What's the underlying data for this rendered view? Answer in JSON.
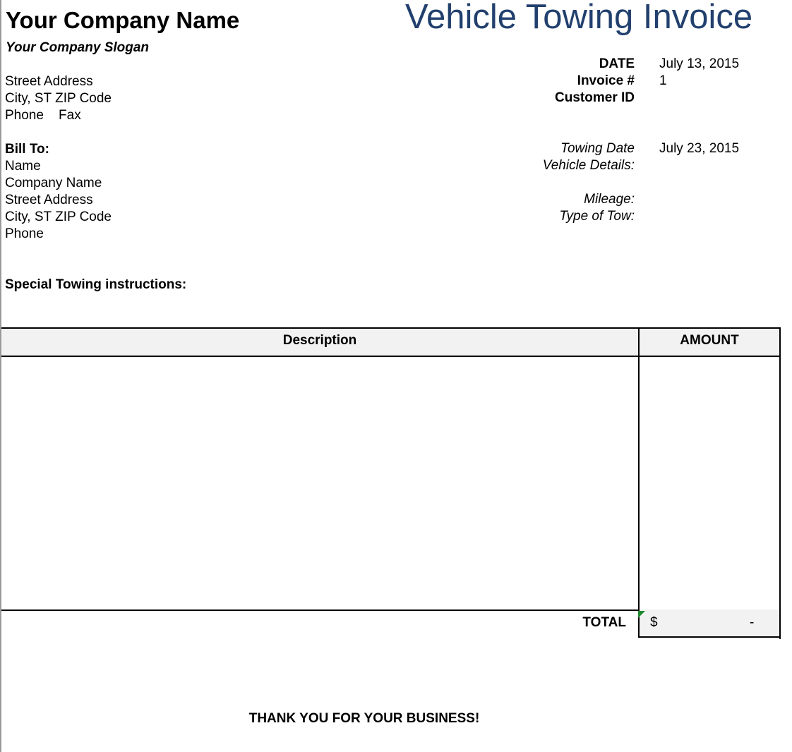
{
  "company": {
    "name": "Your Company Name",
    "slogan": "Your Company Slogan",
    "street": "Street Address",
    "city_line": "City, ST  ZIP Code",
    "phone_fax": "Phone    Fax"
  },
  "invoice": {
    "title": "Vehicle Towing Invoice",
    "title_color": "#22406e",
    "meta": [
      {
        "label": "DATE",
        "value": "July 13, 2015"
      },
      {
        "label": "Invoice #",
        "value": "1"
      },
      {
        "label": "Customer ID",
        "value": ""
      }
    ]
  },
  "bill_to": {
    "heading": "Bill To:",
    "lines": [
      "Name",
      "Company Name",
      "Street Address",
      "City, ST  ZIP Code",
      "Phone"
    ]
  },
  "towing": {
    "fields": [
      {
        "label": "Towing Date",
        "value": "July 23, 2015"
      },
      {
        "label": "Vehicle Details:",
        "value": ""
      },
      {
        "label": "Mileage:",
        "value": ""
      },
      {
        "label": "Type of Tow:",
        "value": ""
      }
    ]
  },
  "special_instructions": {
    "label": "Special Towing instructions:"
  },
  "table": {
    "headers": {
      "description": "Description",
      "amount": "AMOUNT"
    },
    "rows": [],
    "total": {
      "label": "TOTAL",
      "currency": "$",
      "value": "-"
    }
  },
  "footer": {
    "thanks": "THANK YOU FOR YOUR BUSINESS!"
  }
}
